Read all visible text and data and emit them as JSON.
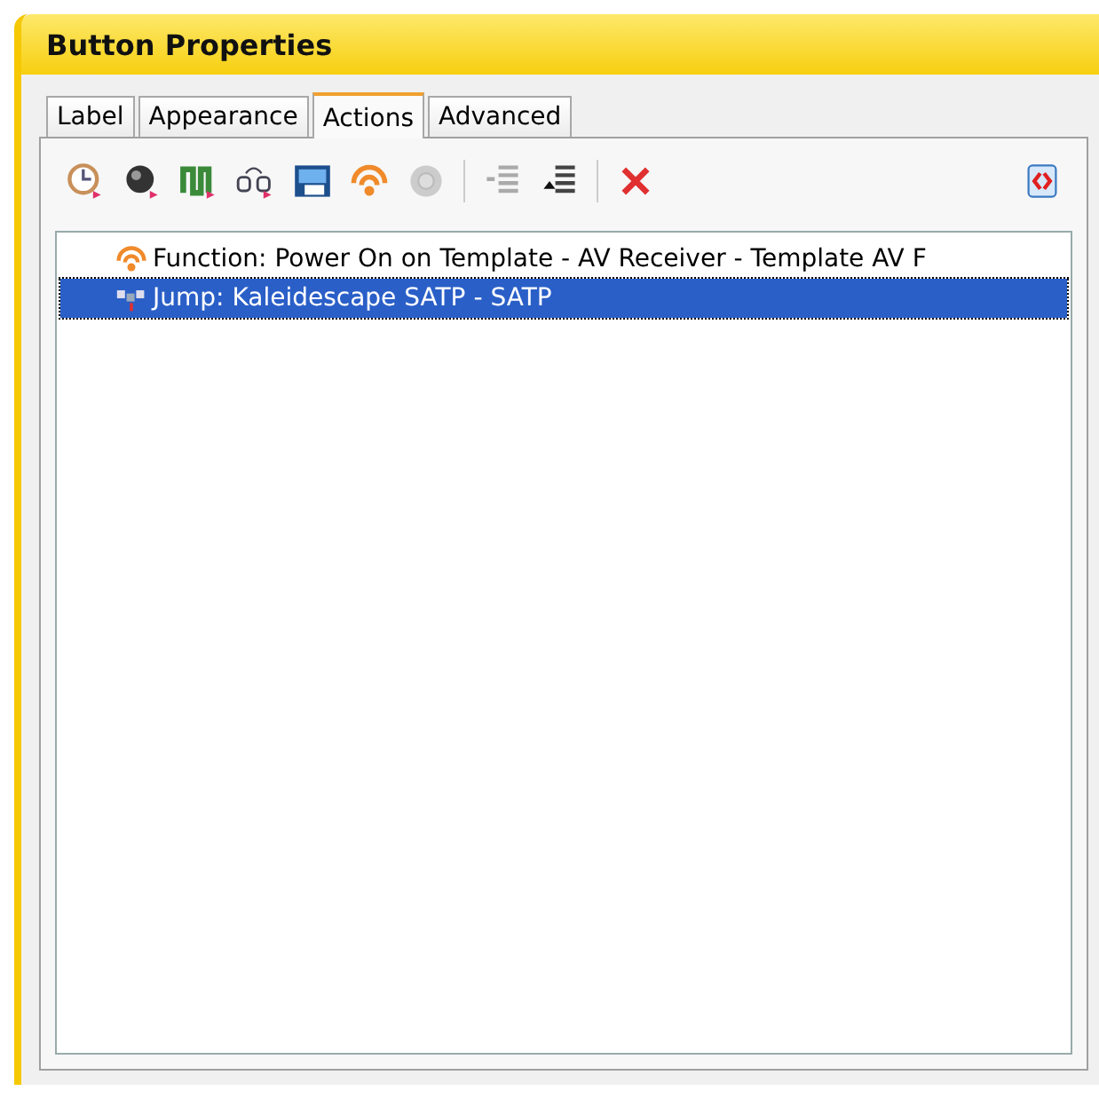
{
  "window": {
    "title": "Button Properties"
  },
  "tabs": [
    {
      "label": "Label",
      "selected": false
    },
    {
      "label": "Appearance",
      "selected": false
    },
    {
      "label": "Actions",
      "selected": true
    },
    {
      "label": "Advanced",
      "selected": false
    }
  ],
  "actions": [
    {
      "kind": "function",
      "label": "Function: Power On on Template - AV Receiver - Template AV F",
      "selected": false
    },
    {
      "kind": "jump",
      "label": "Jump: Kaleidescape SATP - SATP",
      "selected": true
    }
  ]
}
